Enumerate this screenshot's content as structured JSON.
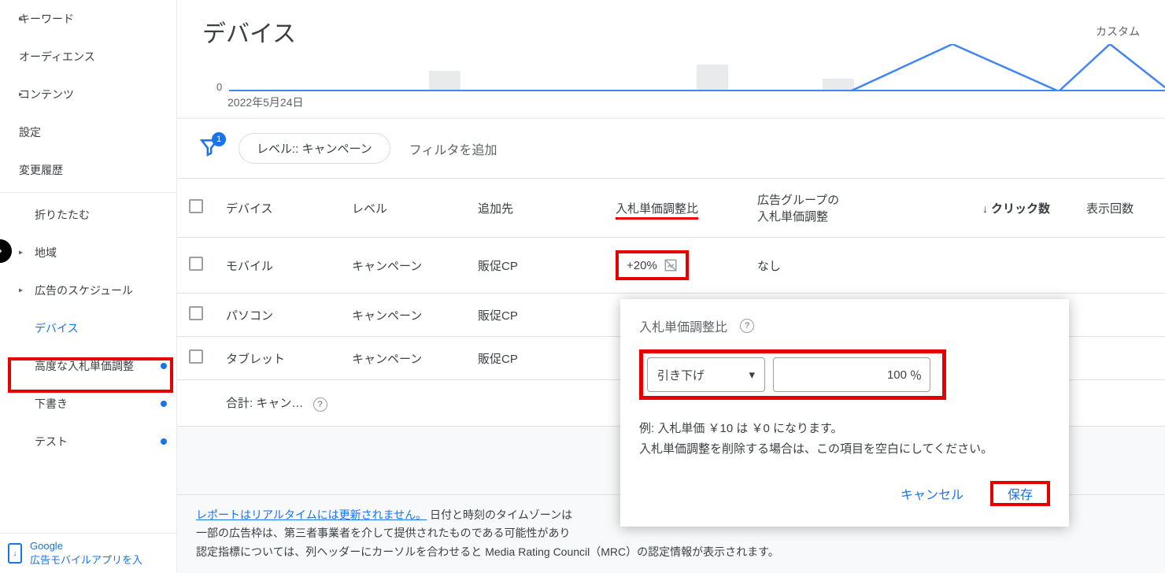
{
  "sidebar": {
    "items": [
      {
        "label": "キーワード",
        "caret": true,
        "indent": false
      },
      {
        "label": "オーディエンス",
        "caret": false,
        "indent": false
      },
      {
        "label": "コンテンツ",
        "caret": true,
        "indent": false
      },
      {
        "label": "設定",
        "caret": false,
        "indent": false
      },
      {
        "label": "変更履歴",
        "caret": false,
        "indent": false
      },
      {
        "label": "折りたたむ",
        "caret": false,
        "indent": true
      },
      {
        "label": "地域",
        "caret": true,
        "indent": true
      },
      {
        "label": "広告のスケジュール",
        "caret": true,
        "indent": true
      },
      {
        "label": "デバイス",
        "caret": false,
        "indent": true,
        "active": true
      },
      {
        "label": "高度な入札単価調整",
        "caret": false,
        "indent": true,
        "dot": true
      },
      {
        "label": "下書き",
        "caret": false,
        "indent": true,
        "dot": true
      },
      {
        "label": "テスト",
        "caret": false,
        "indent": true,
        "dot": true
      }
    ],
    "app_badge": {
      "line1": "Google",
      "line2": "広告モバイルアプリを入"
    }
  },
  "header": {
    "title": "デバイス",
    "custom": "カスタム"
  },
  "chart": {
    "zero": "0",
    "date": "2022年5月24日"
  },
  "filter": {
    "badge": "1",
    "chip": "レベル:: キャンペーン",
    "add": "フィルタを追加"
  },
  "table": {
    "headers": {
      "device": "デバイス",
      "level": "レベル",
      "added": "追加先",
      "bidadj": "入札単価調整比",
      "groupadj": "広告グループの\n入札単価調整",
      "clicks": "クリック数",
      "imps": "表示回数"
    },
    "rows": [
      {
        "device": "モバイル",
        "level": "キャンペーン",
        "added": "販促CP",
        "bidadj": "+20%",
        "groupadj": "なし"
      },
      {
        "device": "パソコン",
        "level": "キャンペーン",
        "added": "販促CP",
        "bidadj": "",
        "groupadj": ""
      },
      {
        "device": "タブレット",
        "level": "キャンペーン",
        "added": "販促CP",
        "bidadj": "",
        "groupadj": ""
      }
    ],
    "total": "合計: キャン…"
  },
  "popover": {
    "title": "入札単価調整比",
    "select": "引き下げ",
    "value": "100",
    "percent": "％",
    "desc1": "例: 入札単価 ￥10 は ￥0 になります。",
    "desc2": "入札単価調整を削除する場合は、この項目を空白にしてください。",
    "cancel": "キャンセル",
    "save": "保存"
  },
  "footer": {
    "link": "レポートはリアルタイムには更新されません。",
    "rest1": " 日付と時刻のタイムゾーンは",
    "line2": "一部の広告枠は、第三者事業者を介して提供されたものである可能性があり",
    "line3": "認定指標については、列ヘッダーにカーソルを合わせると Media Rating Council（MRC）の認定情報が表示されます。"
  },
  "chart_data": {
    "type": "line",
    "title": "",
    "xlabel": "",
    "ylabel": "",
    "x": [
      "2022年5月24日"
    ],
    "series": [
      {
        "name": "clicks",
        "values": [
          0
        ]
      }
    ],
    "ylim": [
      0,
      1
    ]
  }
}
